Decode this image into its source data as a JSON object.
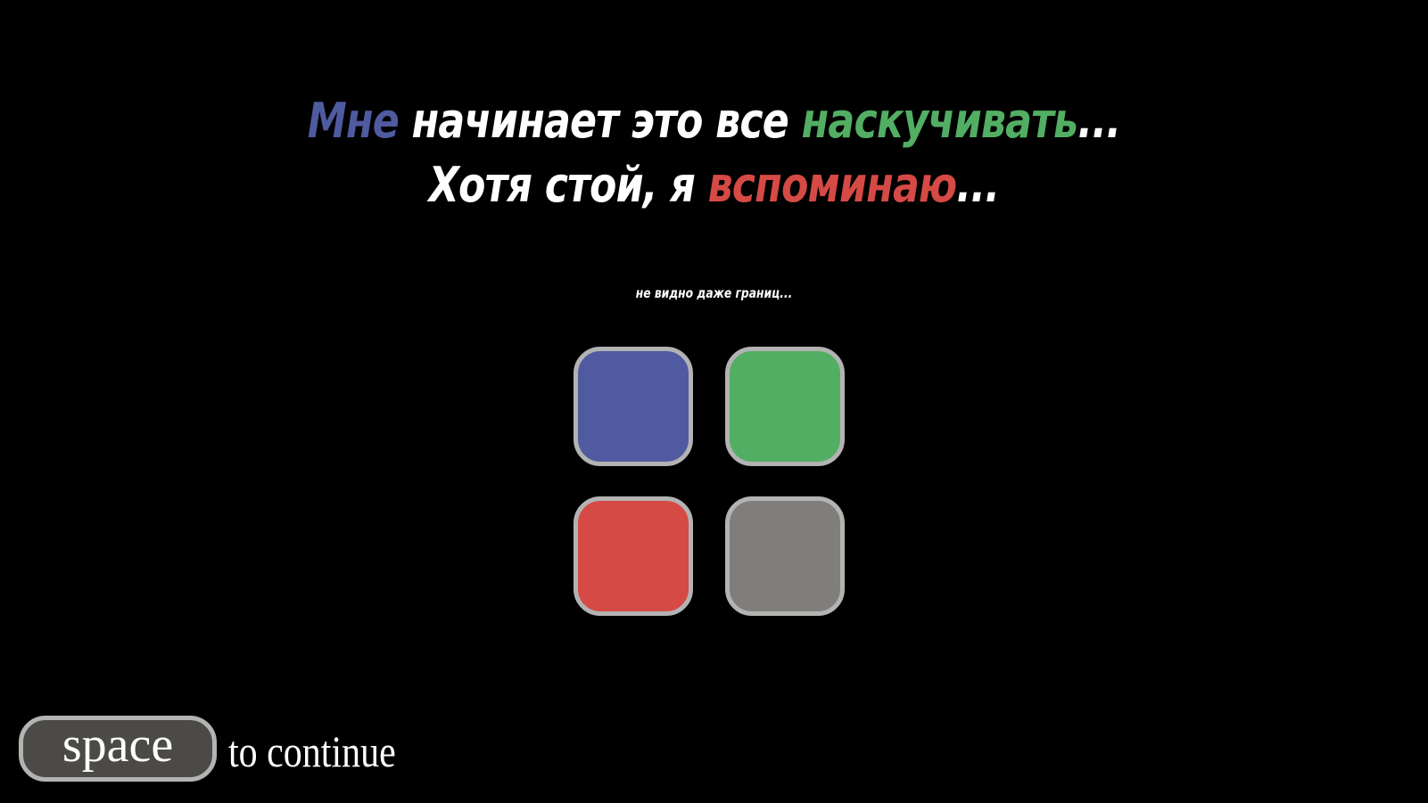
{
  "dialogue": {
    "line1": {
      "word1": "Мне",
      "part2": " начинает это все ",
      "word3": "наскучивать",
      "part4": "..."
    },
    "line2": {
      "part1": "Хотя стой, я ",
      "word2": "вспоминаю",
      "part3": "..."
    }
  },
  "hint": "не видно даже границ...",
  "tiles": [
    {
      "name": "blue",
      "color": "#4f5aa0"
    },
    {
      "name": "green",
      "color": "#52ae63"
    },
    {
      "name": "red",
      "color": "#d54a45"
    },
    {
      "name": "gray",
      "color": "#7f7e7b"
    }
  ],
  "colors": {
    "background": "#000000",
    "text": "#ffffff",
    "blue_word": "#4f5aa0",
    "green_word": "#52ae63",
    "red_word": "#d54a45",
    "tile_border": "#b3b3b3",
    "key_background": "#4b4a47"
  },
  "controls": {
    "key_label": "space",
    "continue_label": "to continue"
  }
}
